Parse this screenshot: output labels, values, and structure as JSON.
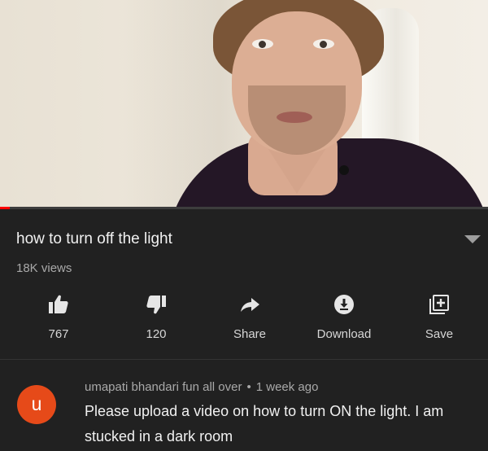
{
  "video": {
    "progress_fraction": 0.02,
    "accent_color": "#ff0000"
  },
  "info": {
    "title": "how to turn off the light",
    "views": "18K views",
    "expand_icon": "chevron-down-icon"
  },
  "actions": [
    {
      "label": "767",
      "icon": "thumbs-up-icon"
    },
    {
      "label": "120",
      "icon": "thumbs-down-icon"
    },
    {
      "label": "Share",
      "icon": "share-arrow-icon"
    },
    {
      "label": "Download",
      "icon": "download-icon"
    },
    {
      "label": "Save",
      "icon": "add-to-playlist-icon"
    }
  ],
  "comment": {
    "avatar_letter": "u",
    "avatar_color": "#e64a19",
    "author": "umapati bhandari fun all over",
    "separator": "•",
    "time": "1 week ago",
    "text": "Please upload a video on how to turn ON the light. I am stucked in a dark room"
  }
}
